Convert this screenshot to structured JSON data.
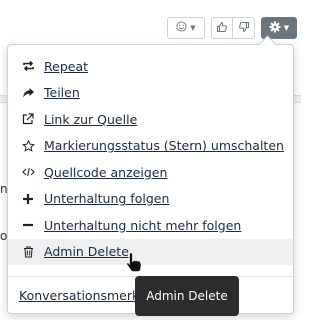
{
  "toolbar": {
    "emoji_icon": "smile-icon",
    "like_icon": "thumbs-up-icon",
    "dislike_icon": "thumbs-down-icon",
    "settings_icon": "gear-icon"
  },
  "background": {
    "frag_a": "ni",
    "frag_b": "o"
  },
  "menu": {
    "items": [
      {
        "icon": "repeat-icon",
        "label": "Repeat"
      },
      {
        "icon": "share-icon",
        "label": "Teilen"
      },
      {
        "icon": "external-link-icon",
        "label": "Link zur Quelle"
      },
      {
        "icon": "star-icon",
        "label": "Markierungsstatus (Stern) umschalten"
      },
      {
        "icon": "code-icon",
        "label": "Quellcode anzeigen"
      },
      {
        "icon": "plus-icon",
        "label": "Unterhaltung folgen"
      },
      {
        "icon": "minus-icon",
        "label": "Unterhaltung nicht mehr folgen"
      },
      {
        "icon": "trash-icon",
        "label": "Admin Delete"
      }
    ],
    "footer_label": "Konversationsmerkmale"
  },
  "tooltip": {
    "text": "Admin Delete"
  }
}
